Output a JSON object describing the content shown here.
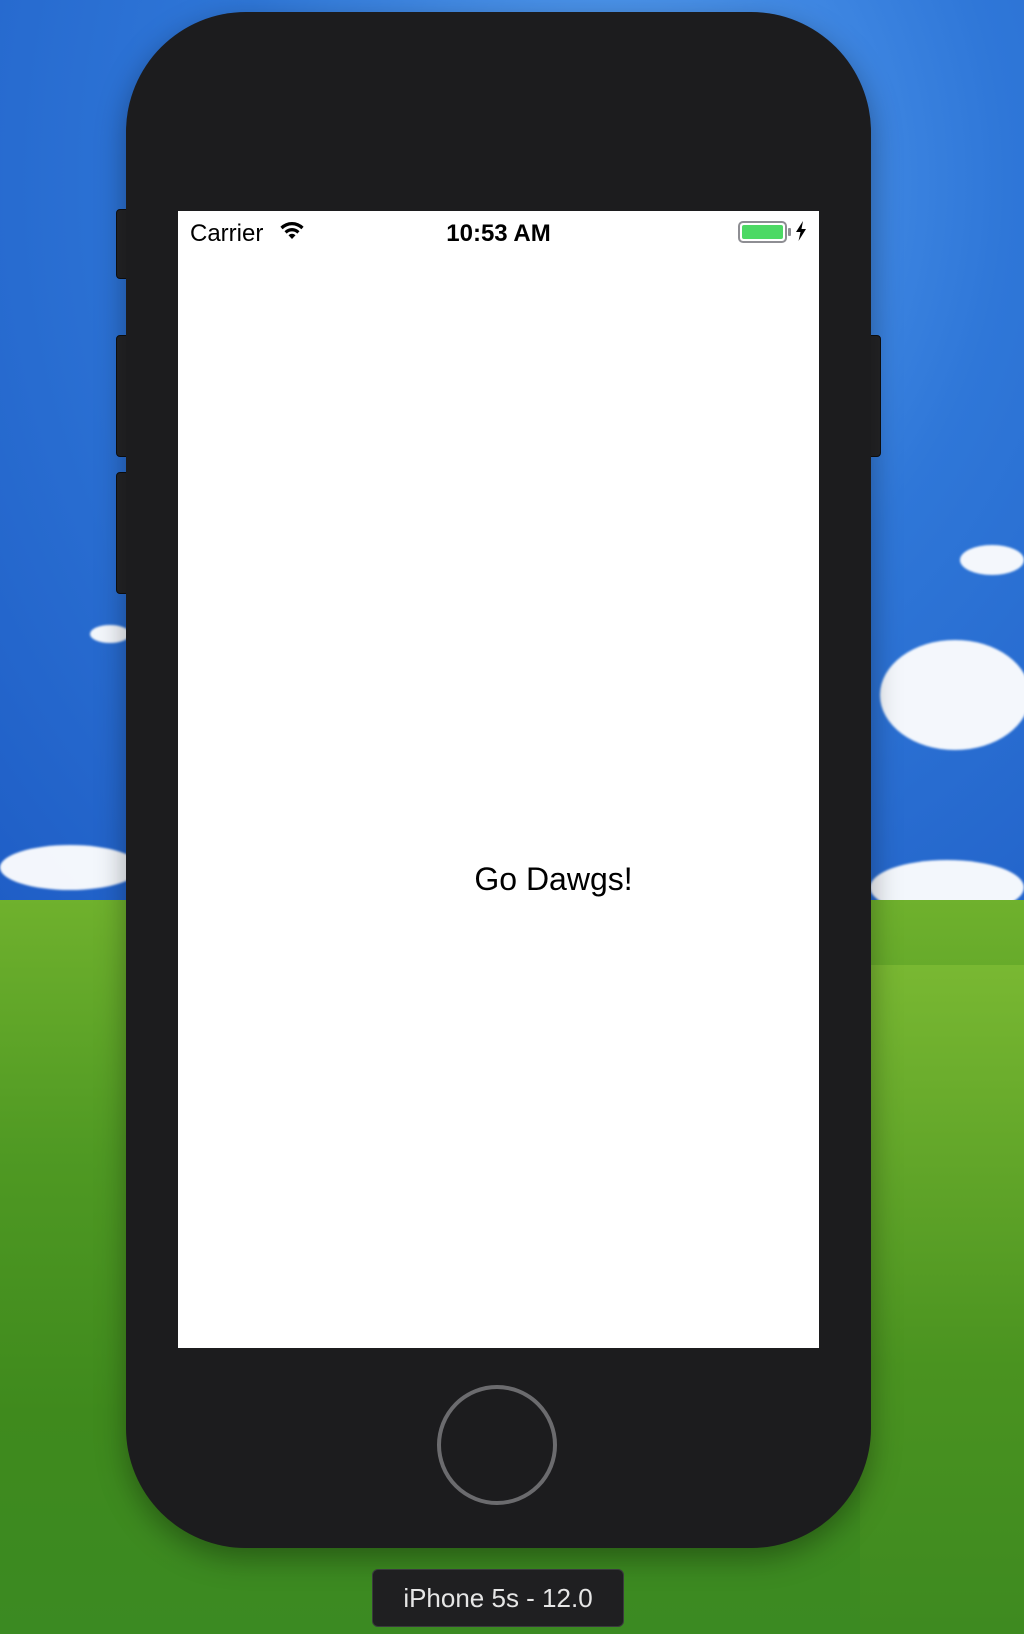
{
  "simulator": {
    "device_label": "iPhone 5s - 12.0"
  },
  "status_bar": {
    "carrier": "Carrier",
    "time": "10:53 AM",
    "battery_color": "#4cd964"
  },
  "screen": {
    "label": "Go Dawgs!"
  },
  "icons": {
    "wifi": "wifi-icon",
    "battery": "battery-icon",
    "charging": "charging-bolt-icon",
    "home": "home-button"
  }
}
